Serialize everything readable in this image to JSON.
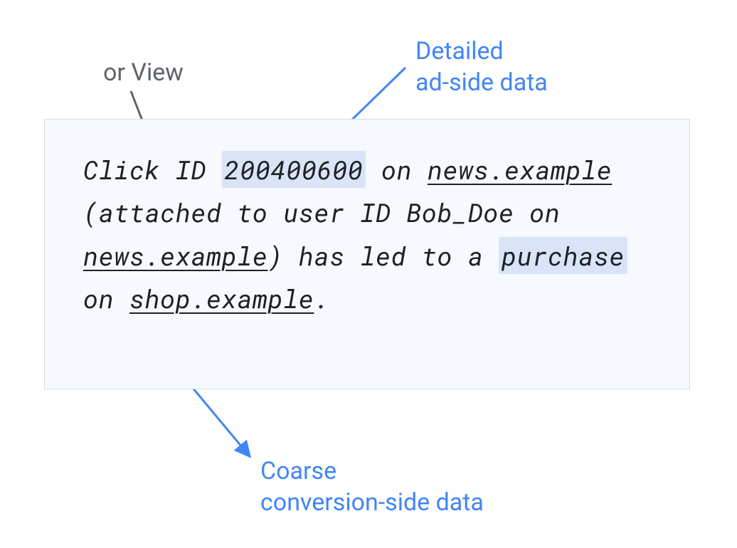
{
  "annotations": {
    "top_gray": "or View",
    "top_blue_line1": "Detailed",
    "top_blue_line2": "ad-side data",
    "bottom_blue_line1": "Coarse",
    "bottom_blue_line2": "conversion-side data"
  },
  "body": {
    "t1": "Click ID ",
    "id": "200400600",
    "t2": " on ",
    "site1": "news.example",
    "t3": " (attached to user ID Bob_Doe on ",
    "site1b": "news.example",
    "t4": ") has led to a ",
    "purchase": "purchase",
    "t5": " on ",
    "site2": "shop.example",
    "t6": "."
  }
}
